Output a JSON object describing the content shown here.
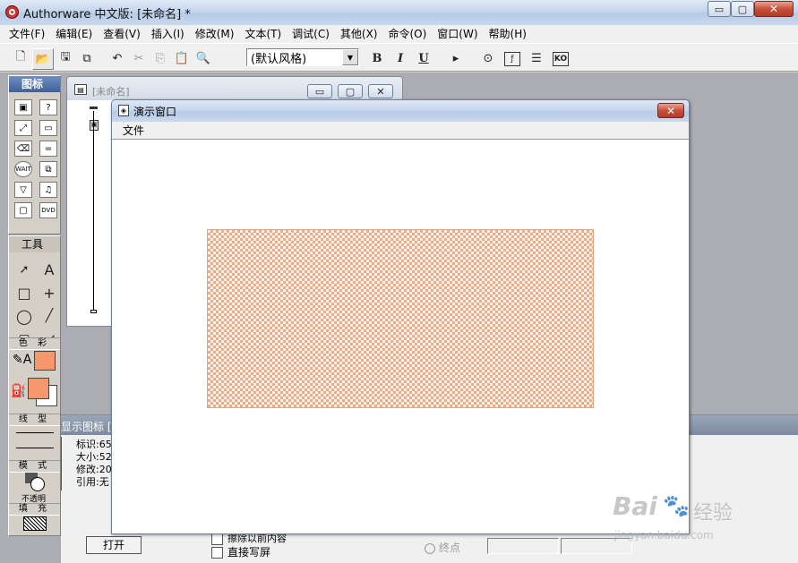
{
  "app": {
    "title": "Authorware 中文版: [未命名] *",
    "controls": [
      "▭",
      "▢",
      "✕"
    ]
  },
  "menu": [
    "文件(F)",
    "编辑(E)",
    "查看(V)",
    "插入(I)",
    "修改(M)",
    "文本(T)",
    "调试(C)",
    "其他(X)",
    "命令(O)",
    "窗口(W)",
    "帮助(H)"
  ],
  "toolbar": {
    "style_select": "(默认风格)",
    "bold": "B",
    "italic": "I",
    "underline": "U"
  },
  "icons_panel": {
    "title": "图标"
  },
  "tools_panel": {
    "title": "工具",
    "color_label": "色 彩",
    "line_label": "线 型",
    "mode_label": "模 式",
    "mode_value": "不透明",
    "fill_label": "填 充",
    "fill_color": "#f7976c"
  },
  "flow_window": {
    "title": "[未命名]"
  },
  "present_window": {
    "title": "演示窗口",
    "menu": [
      "文件"
    ]
  },
  "props_panel": {
    "title_partial": "显示图标 [",
    "rows": [
      "标识:65",
      "大小:52",
      "修改:20",
      "引用:无"
    ],
    "open_button": "打开",
    "checkbox_erase": "擦除以前内容",
    "checkbox_direct": "直接写屏",
    "radio_end": "终点"
  },
  "watermark": {
    "brand": "Bai",
    "brand2": "经验",
    "url": "jingyan.baidu.com"
  }
}
